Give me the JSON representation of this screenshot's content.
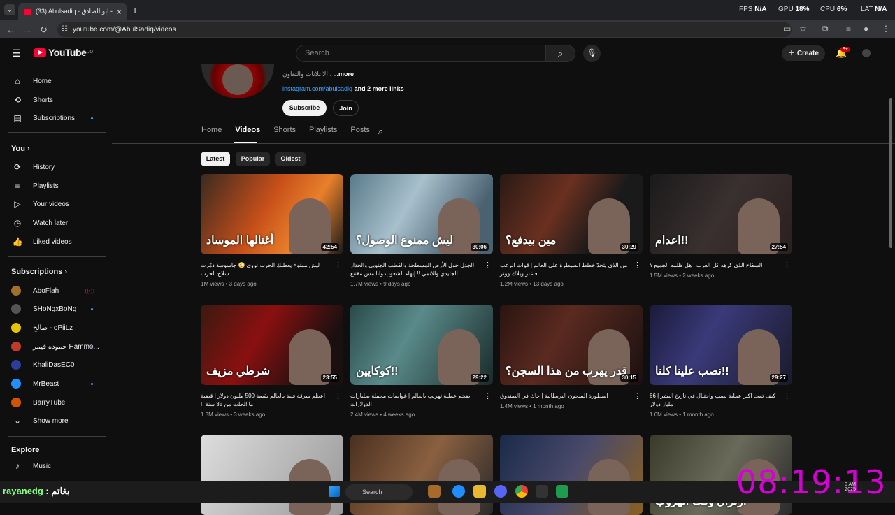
{
  "browser": {
    "tab_title": "(33) Abulsadiq - ابو الصادق - Yo",
    "url": "youtube.com/@AbulSadiq/videos",
    "hud": {
      "fps_label": "FPS",
      "fps_value": "N/A",
      "gpu_label": "GPU",
      "gpu_value": "18%",
      "cpu_label": "CPU",
      "cpu_value": "6%",
      "lat_label": "LAT",
      "lat_value": "N/A"
    }
  },
  "header": {
    "logo_text": "YouTube",
    "logo_region": "JO",
    "search_placeholder": "Search",
    "create_label": "Create",
    "notif_count": "9+"
  },
  "sidebar": {
    "main": [
      {
        "label": "Home",
        "icon": "home-icon"
      },
      {
        "label": "Shorts",
        "icon": "shorts-icon"
      },
      {
        "label": "Subscriptions",
        "icon": "subscriptions-icon"
      }
    ],
    "you_heading": "You",
    "you": [
      {
        "label": "History",
        "icon": "history-icon"
      },
      {
        "label": "Playlists",
        "icon": "playlists-icon"
      },
      {
        "label": "Your videos",
        "icon": "your-videos-icon"
      },
      {
        "label": "Watch later",
        "icon": "watch-later-icon"
      },
      {
        "label": "Liked videos",
        "icon": "liked-icon"
      }
    ],
    "subs_heading": "Subscriptions",
    "subs": [
      {
        "label": "AboFlah",
        "color": "#a3702a",
        "state": "live"
      },
      {
        "label": "SHoNgxBoNg",
        "color": "#444",
        "state": "dot"
      },
      {
        "label": "صالح - oPiiLz",
        "color": "#e6c300",
        "state": ""
      },
      {
        "label": "حموده فيمر Hammo...",
        "color": "#c0392b",
        "state": "dot"
      },
      {
        "label": "KhaliDasEC0",
        "color": "#2c3e9b",
        "state": ""
      },
      {
        "label": "MrBeast",
        "color": "#1e90ff",
        "state": "dot"
      },
      {
        "label": "BarryTube",
        "color": "#d35400",
        "state": ""
      }
    ],
    "show_more": "Show more",
    "explore_heading": "Explore",
    "explore": [
      {
        "label": "Music",
        "icon": "music-icon"
      }
    ]
  },
  "channel": {
    "description": "الاعلانات والتعاون : ",
    "more": "...more",
    "link": "instagram.com/abulsadiq",
    "more_links": "and 2 more links",
    "subscribe": "Subscribe",
    "join": "Join",
    "tabs": [
      "Home",
      "Videos",
      "Shorts",
      "Playlists",
      "Posts"
    ],
    "active_tab": "Videos",
    "chips": [
      "Latest",
      "Popular",
      "Oldest"
    ]
  },
  "videos": [
    {
      "title": "ليش ممنوع يعطلك الحرب نووي 😳 جاسوسة دمّرت سلاح الحرب",
      "meta": "1M views • 3 days ago",
      "duration": "42:54",
      "overlay": "أغتالها الموساد",
      "bg": "linear-gradient(120deg,#3a2a20,#c8501a 45%,#e8802a 70%,#1a1a1a)"
    },
    {
      "title": "الجدل حول الأرض المسطحة والقطب الجنوبي والجدار الجليدي والانمي !! إنهاء الشعوب وانا مش مقتنع",
      "meta": "1.7M views • 9 days ago",
      "duration": "30:06",
      "overlay": "ليش ممنوع الوصول؟",
      "bg": "linear-gradient(120deg,#5a7a8a,#a8c0cc 40%,#4a6270 80%)"
    },
    {
      "title": "من الذي يتحدّ خطط السيطرة على العالم | قوات الرعب فاغنر وبلاك ووتر",
      "meta": "1.2M views • 13 days ago",
      "duration": "30:29",
      "overlay": "مين بيدفع؟",
      "bg": "linear-gradient(120deg,#2a1a14,#6a3020 40%,#1a1a1a 70%)"
    },
    {
      "title": "السفاح الذي كرهه كل العرب | هل ظلمه الجميع ؟",
      "meta": "1.5M views • 2 weeks ago",
      "duration": "27:54",
      "overlay": "اعدام!!",
      "bg": "linear-gradient(120deg,#1a1a1a,#3a3030 50%,#2a2020)"
    },
    {
      "title": "اعظم سرقة فنية بالعالم بقيمة 500 مليون دولار | قضية ما الحلت من 35 سنة !!",
      "meta": "1.3M views • 3 weeks ago",
      "duration": "23:55",
      "overlay": "شرطي مزيف",
      "bg": "linear-gradient(120deg,#3a1a10,#8a1010 40%,#1a1010 80%)"
    },
    {
      "title": "اضخم عملية تهريب بالعالم | غواصات محملة بمليارات الدولارات",
      "meta": "2.4M views • 4 weeks ago",
      "duration": "29:22",
      "overlay": "كوكايين!!",
      "bg": "linear-gradient(120deg,#2a4a4a,#5a8a8a 40%,#1a2a2a)"
    },
    {
      "title": "اسطورة السجون البريطانية | جاك في الصندوق",
      "meta": "1.4M views • 1 month ago",
      "duration": "30:15",
      "overlay": "قدر يهرب من هذا السجن؟",
      "bg": "linear-gradient(120deg,#2a1410,#5a2a20 40%,#1a1010)"
    },
    {
      "title": "كيف تمت اكبر عملية نصب واحتيال في تاريخ البشر | 66 مليار دولار",
      "meta": "1.6M views • 1 month ago",
      "duration": "29:27",
      "overlay": "نصب علينا كلنا!!",
      "bg": "linear-gradient(120deg,#1a1a3a,#3a3a7a 40%,#1a1a2a)"
    },
    {
      "title": "",
      "meta": "",
      "duration": "",
      "overlay": "",
      "bg": "linear-gradient(120deg,#ddd,#bbb 50%,#999)"
    },
    {
      "title": "",
      "meta": "",
      "duration": "",
      "overlay": "",
      "bg": "linear-gradient(120deg,#4a3020,#8a6040 50%,#2a2a2a)"
    },
    {
      "title": "",
      "meta": "",
      "duration": "",
      "overlay": "",
      "bg": "linear-gradient(120deg,#1a2a4a,#4a4a6a 50%,#8a6020)"
    },
    {
      "title": "",
      "meta": "",
      "duration": "",
      "overlay": "زلزال وقت الهروب!",
      "bg": "linear-gradient(120deg,#3a3a2a,#6a6a5a 50%,#2a2a2a)"
    }
  ],
  "taskbar": {
    "user": "rayanedg",
    "user_suffix": " : بغاتم",
    "search": "Search",
    "clock": "08:19:13",
    "time_small": "0 AM",
    "date_small": "2025"
  }
}
